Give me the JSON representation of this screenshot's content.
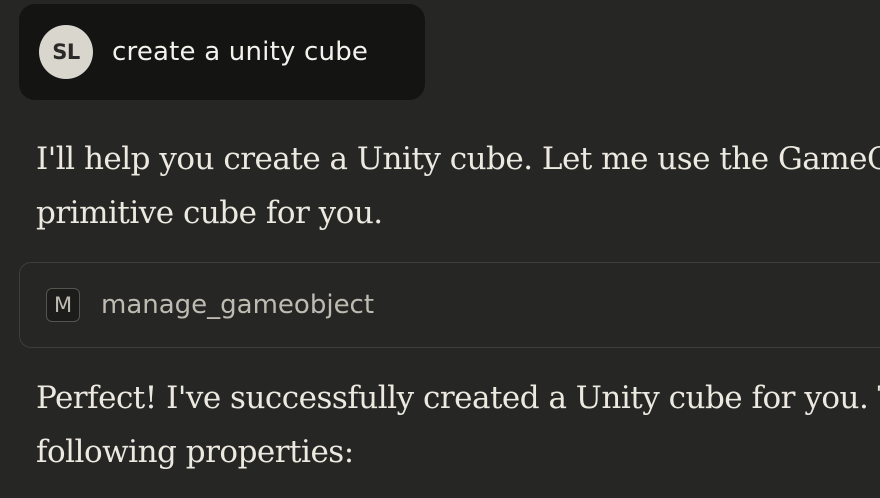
{
  "user_message": {
    "avatar_initials": "SL",
    "text": "create a unity cube"
  },
  "assistant": {
    "paragraph_1": {
      "line_1": "I'll help you create a Unity cube. Let me use the GameObject",
      "line_2": "primitive cube for you."
    },
    "tool_call": {
      "icon_letter": "M",
      "name": "manage_gameobject"
    },
    "paragraph_2": {
      "line_1": "Perfect! I've successfully created a Unity cube for you. The",
      "line_2": "following properties:"
    }
  },
  "colors": {
    "background": "#262624",
    "user_bubble": "#141413",
    "avatar_bg": "#d9d6cd",
    "text_primary": "#ece9e1",
    "text_muted": "#bebbb2",
    "border": "#3e3e3a"
  }
}
